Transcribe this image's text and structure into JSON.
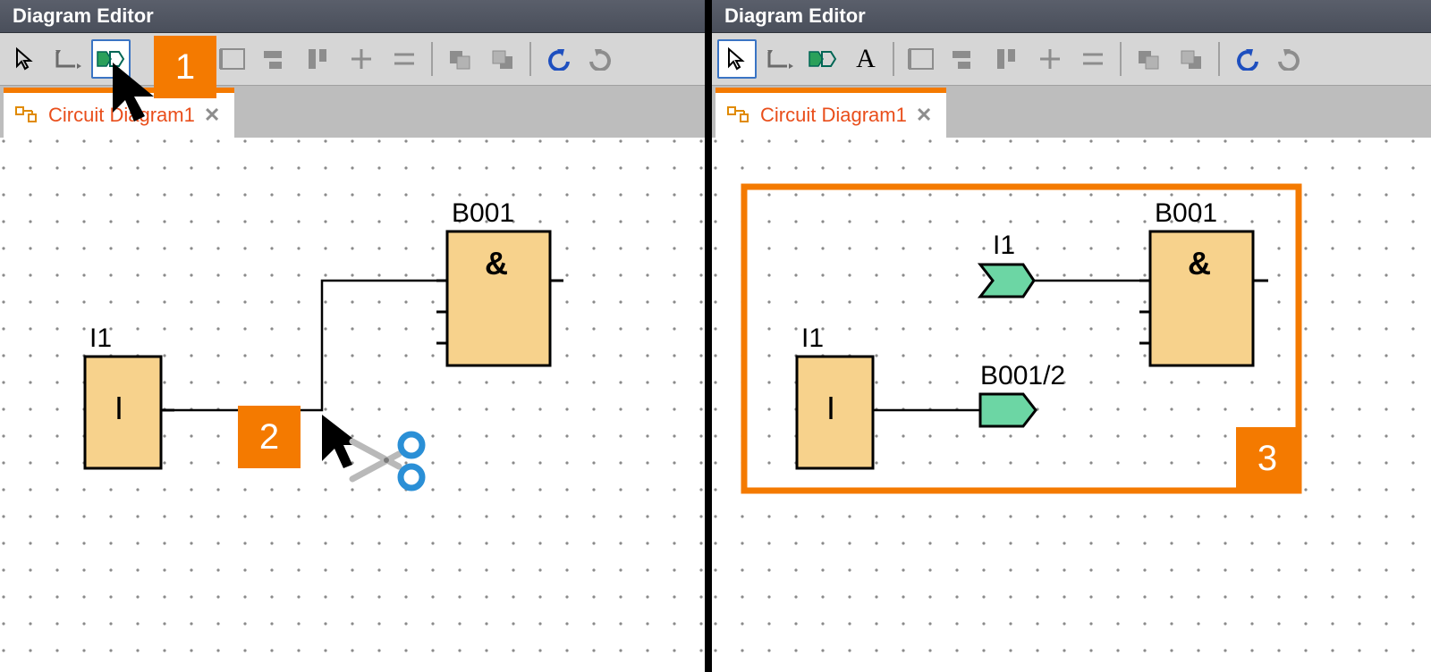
{
  "app_title": "Diagram Editor",
  "tab_label": "Circuit Diagram1",
  "callouts": {
    "c1": "1",
    "c2": "2",
    "c3": "3"
  },
  "colors": {
    "accent": "#f47a00",
    "tab_text": "#e94e1b",
    "block_fill": "#f7d28c",
    "block_stroke": "#000000",
    "conn_fill": "#6cd6a4",
    "undo": "#1e4fbf"
  },
  "left_diagram": {
    "blocks": {
      "B001": {
        "label": "B001",
        "symbol": "&"
      },
      "I1": {
        "label": "I1",
        "symbol": "I"
      }
    }
  },
  "right_diagram": {
    "blocks": {
      "B001": {
        "label": "B001",
        "symbol": "&"
      },
      "I1_block": {
        "label": "I1",
        "symbol": "I"
      },
      "I1_conn": {
        "label": "I1"
      },
      "B001_2": {
        "label": "B001/2"
      }
    }
  }
}
